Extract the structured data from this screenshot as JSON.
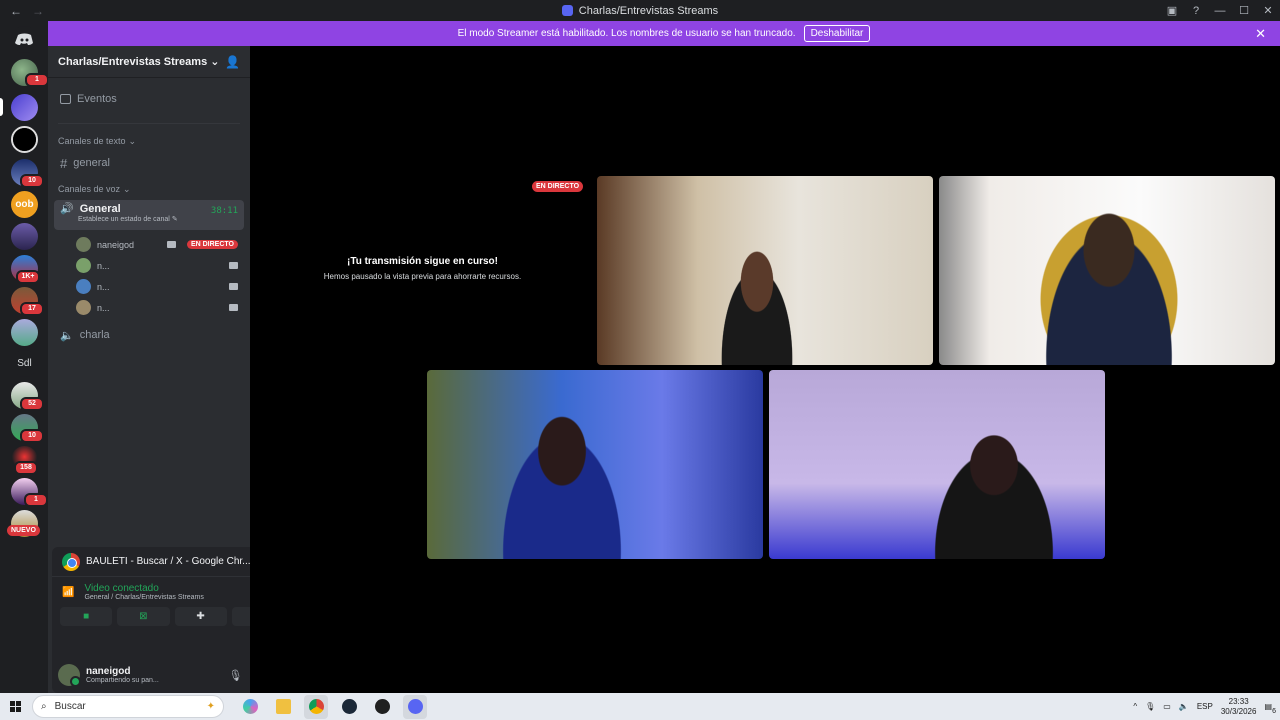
{
  "window": {
    "title": "Charlas/Entrevistas Streams"
  },
  "banner": {
    "text": "El modo Streamer está habilitado. Los nombres de usuario se han truncado.",
    "button": "Deshabilitar"
  },
  "guilds": {
    "badges": [
      "1",
      "10",
      "1K+",
      "17",
      "52",
      "10",
      "158",
      "1"
    ],
    "text_server": "Sdl",
    "nuevo": "NUEVO"
  },
  "server": {
    "name": "Charlas/Entrevistas Streams",
    "events": "Eventos",
    "text_category": "Canales de texto",
    "text_channels": [
      "general"
    ],
    "voice_category": "Canales de voz",
    "active_voice": {
      "name": "General",
      "status": "Establece un estado de canal",
      "timer": "38:11"
    },
    "voice_users": [
      {
        "name": "naneigod",
        "live": "EN DIRECTO"
      },
      {
        "name": "n..."
      },
      {
        "name": "n..."
      },
      {
        "name": "n..."
      }
    ],
    "other_voice": "charla"
  },
  "panel": {
    "share_title": "BAULETI - Buscar / X - Google Chr...",
    "connection": "Video conectado",
    "connection_sub": "General / Charlas/Entrevistas Streams",
    "username": "naneigod",
    "user_status": "Compartiendo su pan..."
  },
  "stage": {
    "live_badge": "EN DIRECTO",
    "paused_title": "¡Tu transmisión sigue en curso!",
    "paused_text": "Hemos pausado la vista previa para ahorrarte recursos."
  },
  "taskbar": {
    "search": "Buscar",
    "lang": "ESP",
    "time": "23:33",
    "date": "30/3/2026",
    "notifications": "6"
  }
}
